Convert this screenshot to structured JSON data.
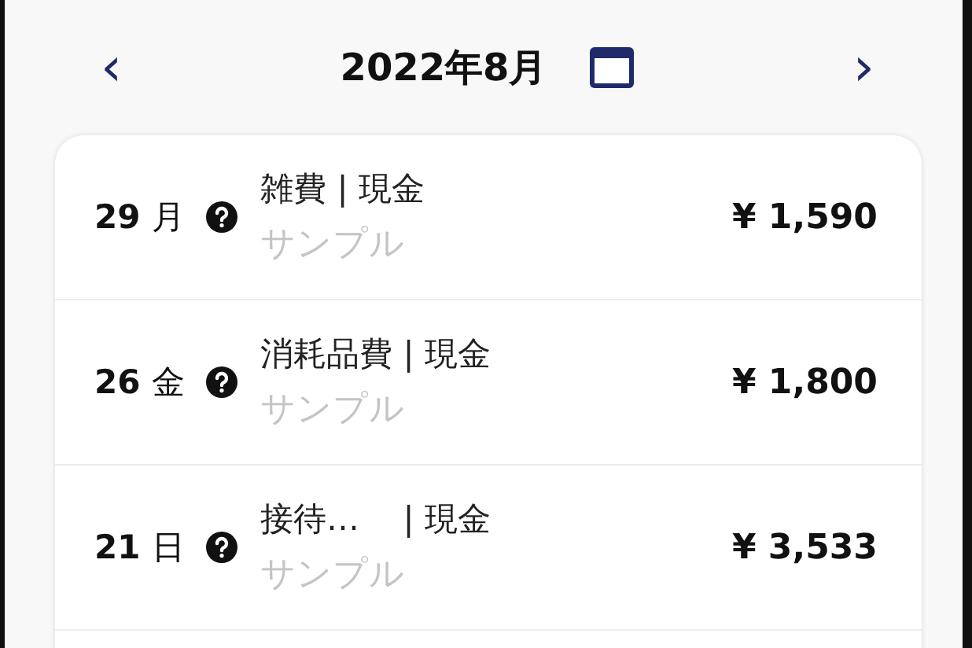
{
  "header": {
    "prev": "‹",
    "month": "2022年8月",
    "next": "›"
  },
  "entries": [
    {
      "date": "29",
      "weekday": "月",
      "title": "雑費 | 現金",
      "memo": "サンプル",
      "amount": "¥ 1,590"
    },
    {
      "date": "26",
      "weekday": "金",
      "title": "消耗品費 | 現金",
      "memo": "サンプル",
      "amount": "¥ 1,800"
    },
    {
      "date": "21",
      "weekday": "日",
      "title": "接待…　 | 現金",
      "memo": "サンプル",
      "amount": "¥ 3,533"
    }
  ]
}
